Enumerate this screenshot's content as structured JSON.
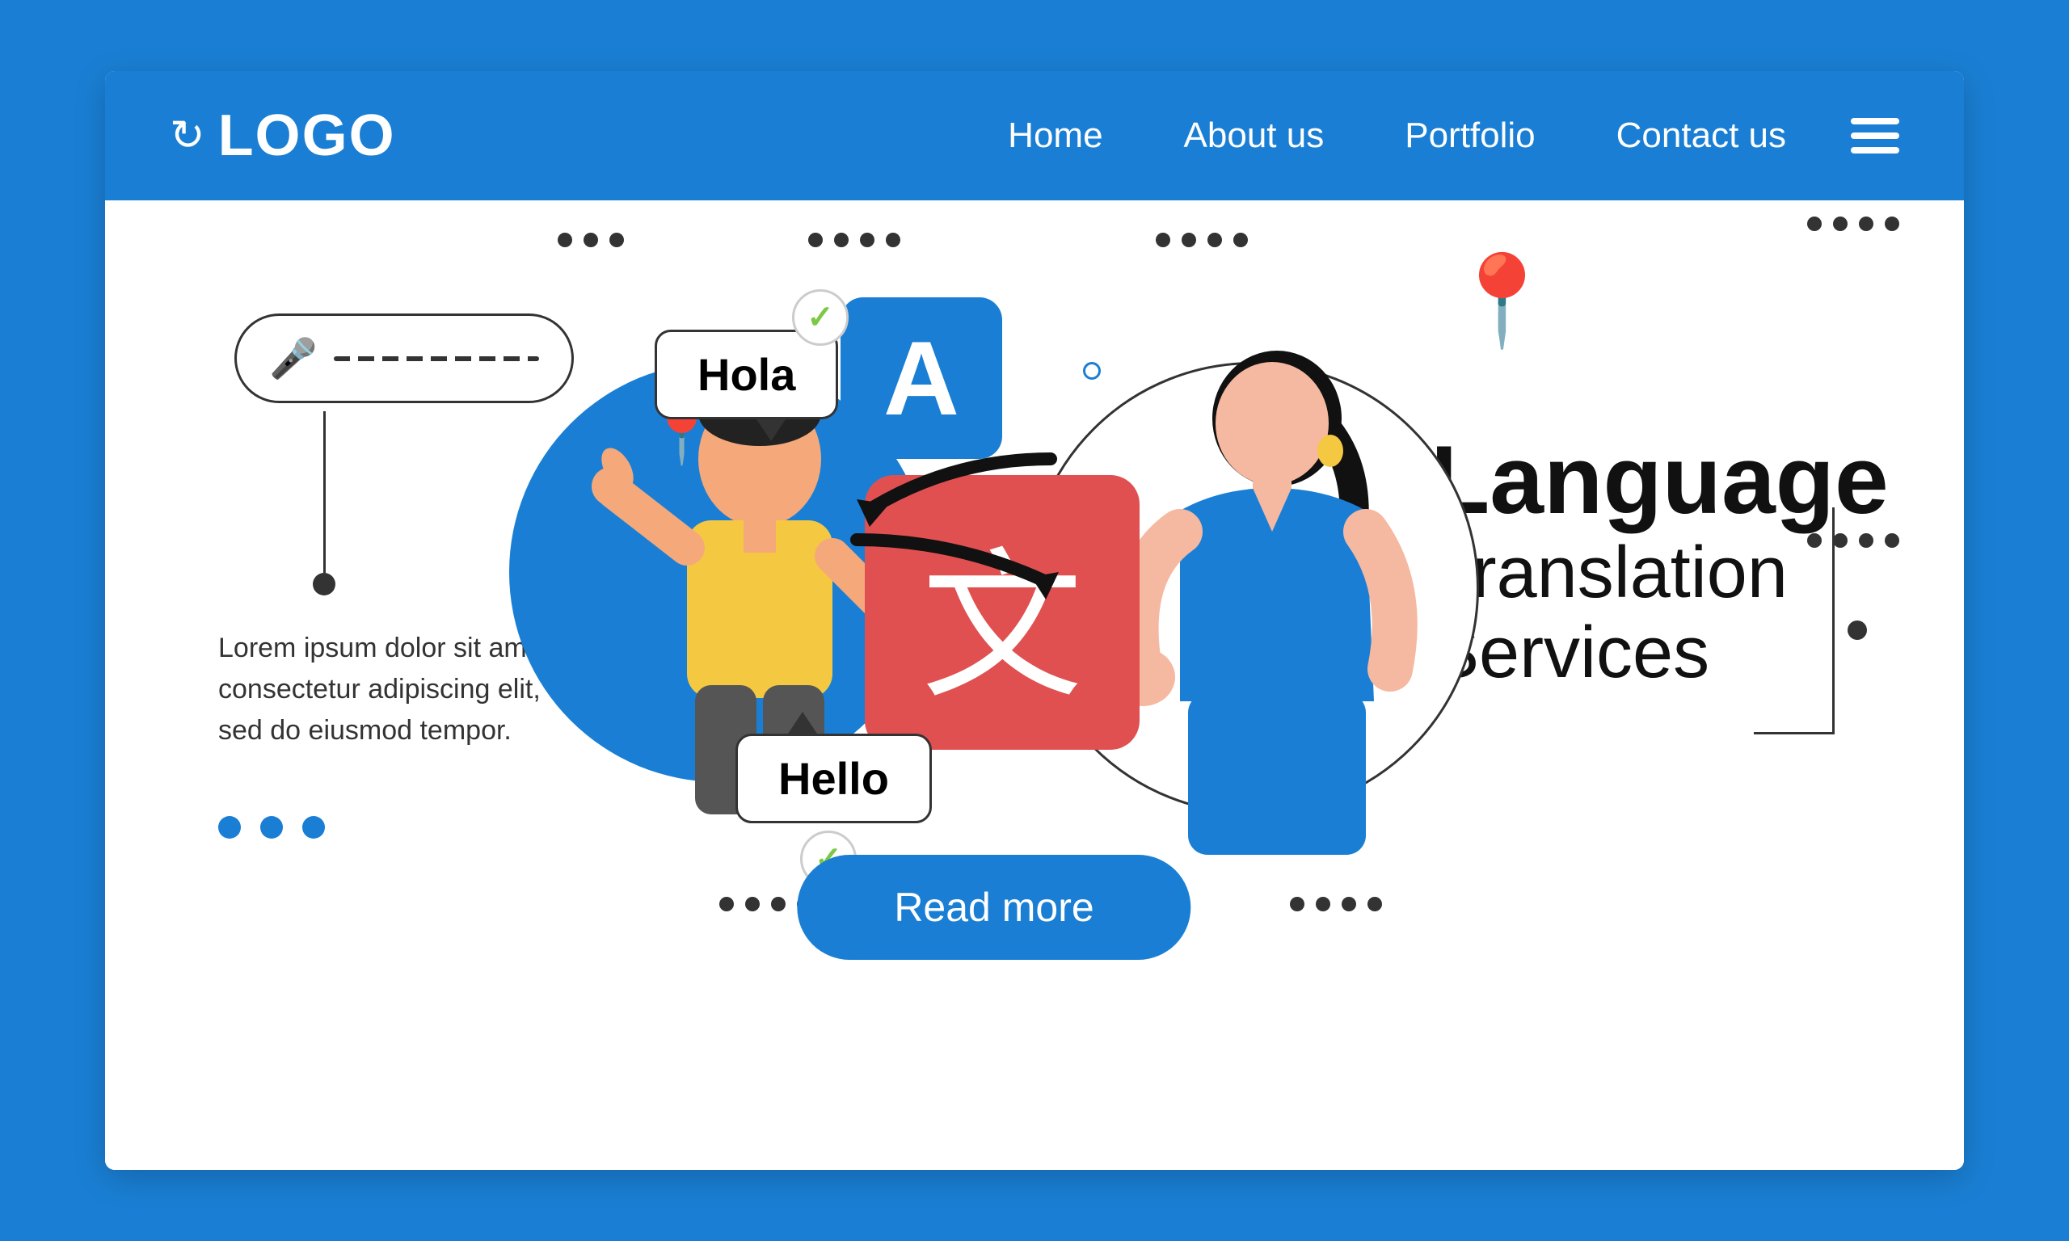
{
  "page": {
    "background_color": "#1a7fd4",
    "title": "Language Translation Services"
  },
  "navbar": {
    "logo_text": "LOGO",
    "logo_icon": "↻",
    "links": [
      {
        "label": "Home",
        "id": "nav-home"
      },
      {
        "label": "About us",
        "id": "nav-about"
      },
      {
        "label": "Portfolio",
        "id": "nav-portfolio"
      },
      {
        "label": "Contact us",
        "id": "nav-contact"
      }
    ]
  },
  "hero": {
    "hola_bubble": "Hola",
    "hello_bubble": "Hello",
    "a_card_letter": "A",
    "chinese_char": "文",
    "lorem_text": "Lorem ipsum dolor sit amet, consectetur adipiscing elit, sed do eiusmod tempor.",
    "read_more": "Read more",
    "title_line1": "Language",
    "title_line2": "Translation",
    "title_line3": "Services"
  }
}
